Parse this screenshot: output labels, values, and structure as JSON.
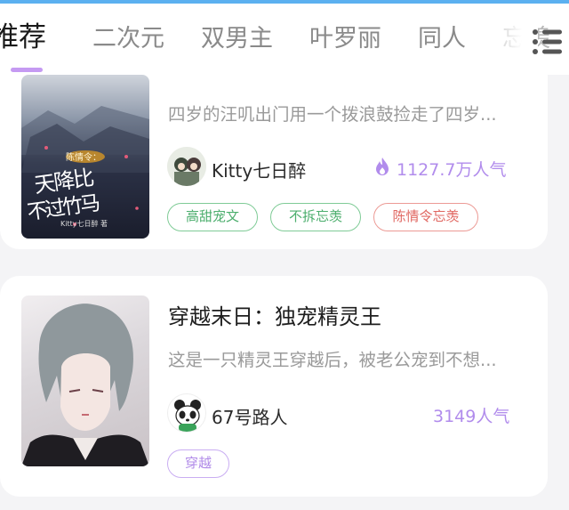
{
  "tabs": [
    {
      "label": "推荐",
      "active": true
    },
    {
      "label": "二次元"
    },
    {
      "label": "双男主"
    },
    {
      "label": "叶罗丽"
    },
    {
      "label": "同人"
    },
    {
      "label": "忘羡"
    }
  ],
  "colors": {
    "accent": "#c59af2",
    "tag_green": "#4cae6d",
    "tag_red": "#e06660",
    "tag_purple": "#b08ae8"
  },
  "books": [
    {
      "cover_text": {
        "top": "陈情令：",
        "main_1": "天降比",
        "main_2": "不过竹马",
        "byline": "Kitty七日醉 著"
      },
      "description": "四岁的汪叽出门用一个拨浪鼓捡走了四岁...",
      "author": "Kitty七日醉",
      "popularity": "1127.7万人气",
      "popularity_icon": "flame-icon",
      "tags": [
        {
          "label": "高甜宠文",
          "color": "green"
        },
        {
          "label": "不拆忘羡",
          "color": "green"
        },
        {
          "label": "陈情令忘羡",
          "color": "red"
        }
      ]
    },
    {
      "title": "穿越末日：独宠精灵王",
      "description": "这是一只精灵王穿越后，被老公宠到不想...",
      "author": "67号路人",
      "avatar_icon": "panda-icon",
      "popularity": "3149人气",
      "tags": [
        {
          "label": "穿越",
          "color": "purple"
        }
      ]
    }
  ]
}
